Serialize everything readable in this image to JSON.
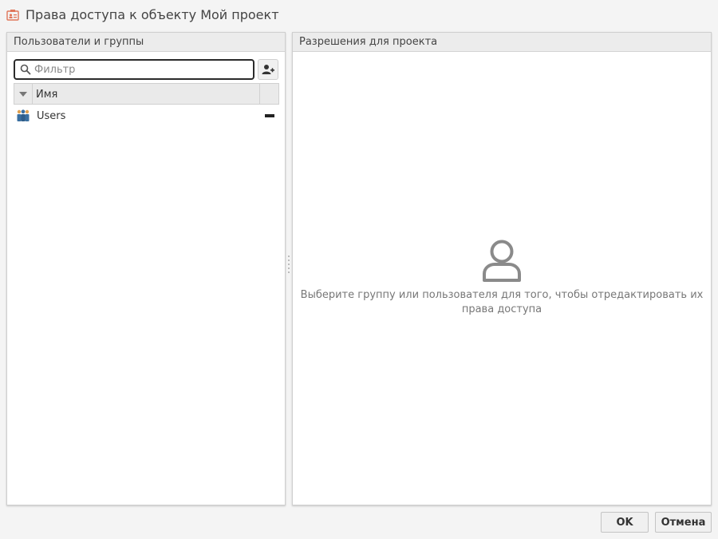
{
  "window": {
    "title": "Права доступа к объекту Мой проект"
  },
  "left_panel": {
    "header": "Пользователи и группы",
    "filter": {
      "placeholder": "Фильтр",
      "value": ""
    },
    "grid": {
      "columns": [
        "Имя"
      ],
      "rows": [
        {
          "label": "Users",
          "icon": "users-group-icon"
        }
      ]
    }
  },
  "right_panel": {
    "header": "Разрешения для проекта",
    "empty_message": "Выберите группу или пользователя для того, чтобы отредактировать их права доступа"
  },
  "footer": {
    "ok_label": "OK",
    "cancel_label": "Отмена"
  },
  "colors": {
    "title_icon": "#e0765a",
    "users_icon": "#3a6fa0",
    "empty_icon": "#8a8a8a"
  }
}
